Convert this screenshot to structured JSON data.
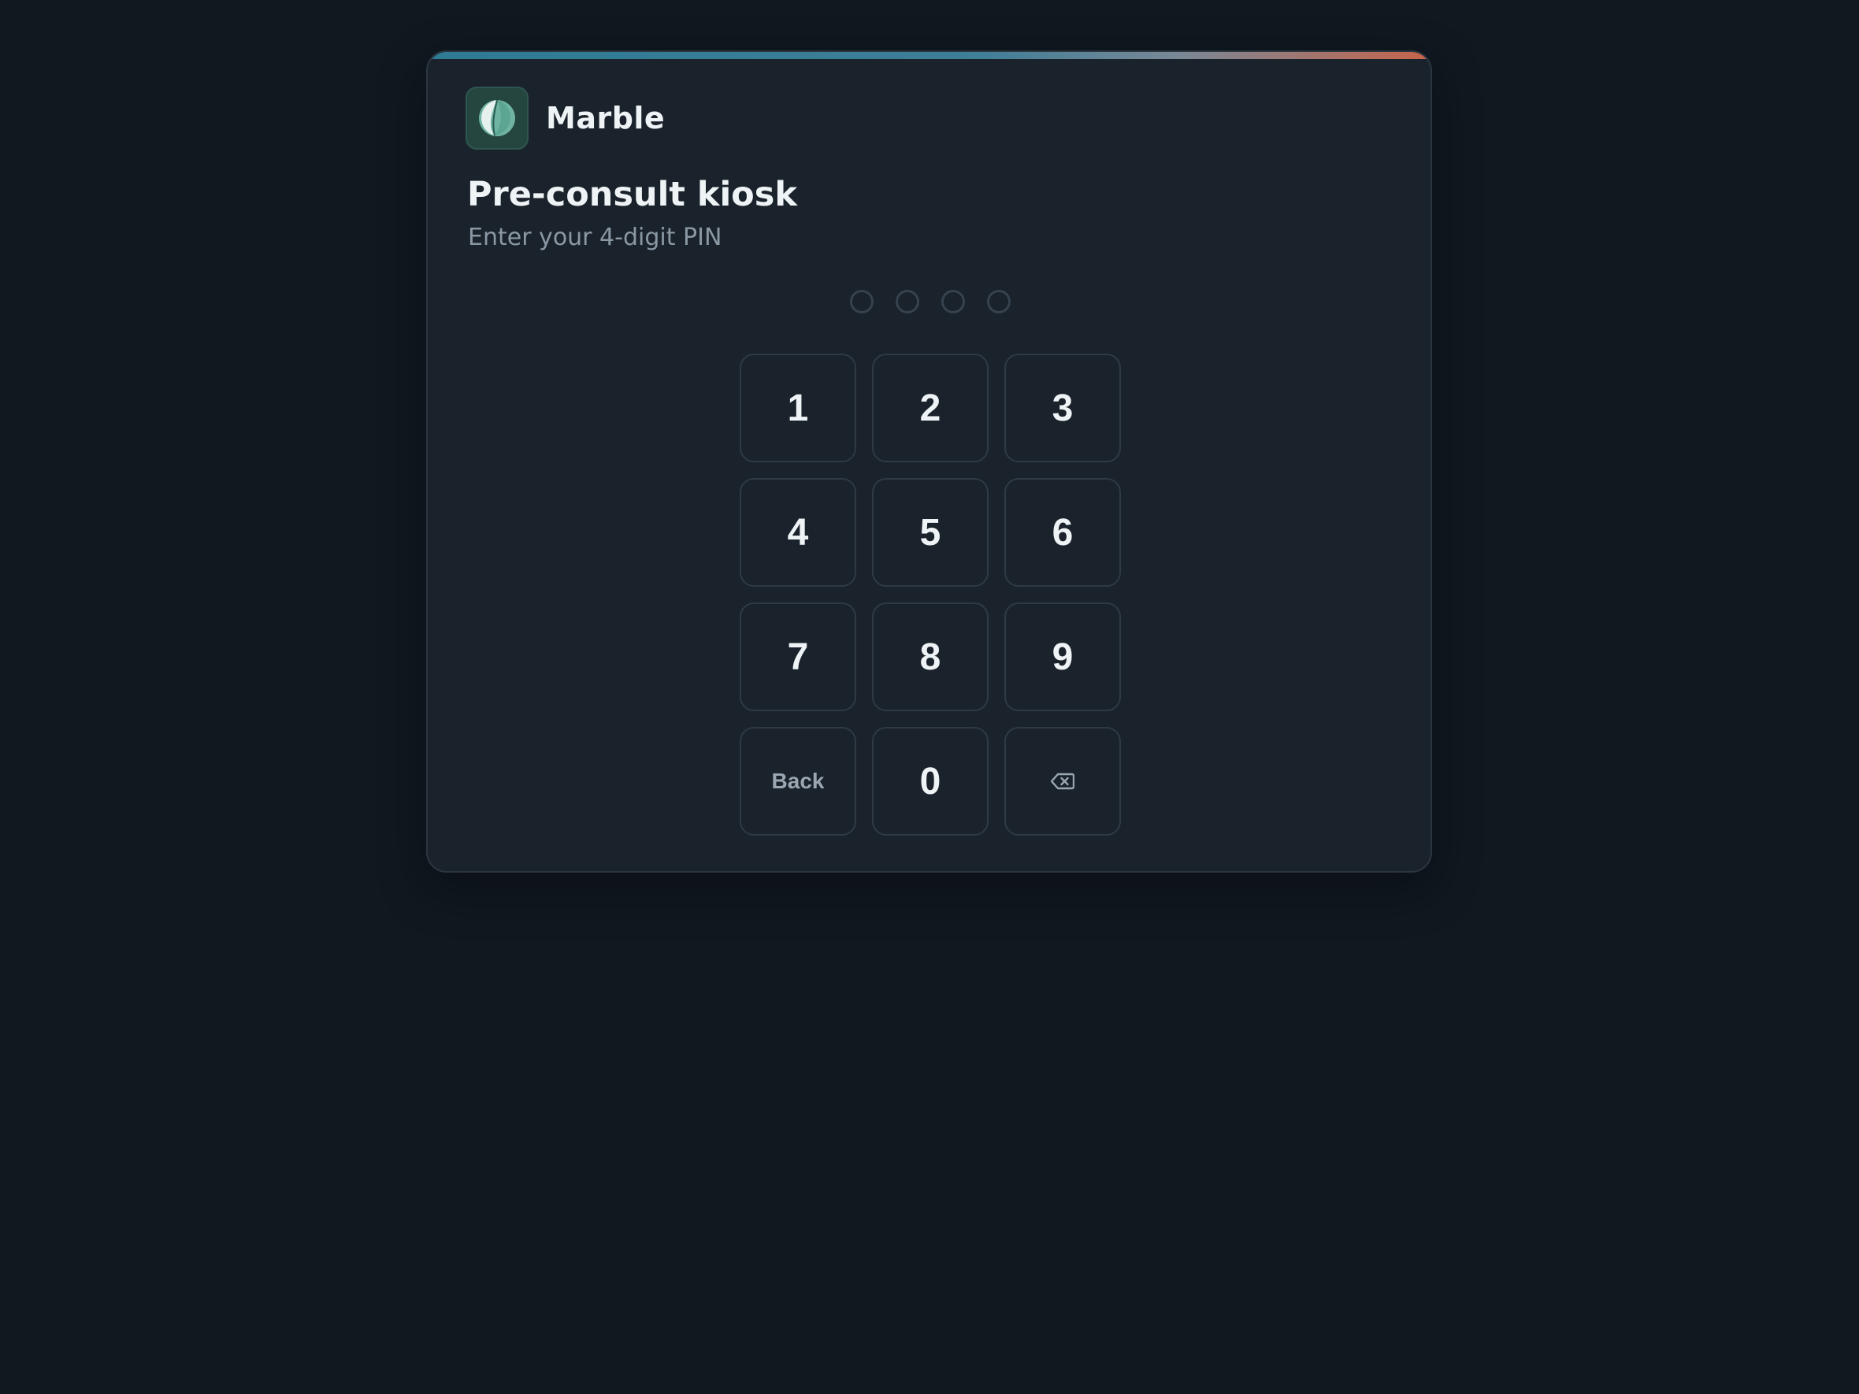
{
  "brand": {
    "name": "Marble",
    "logo_icon": "marble-logo-icon"
  },
  "kiosk": {
    "title": "Pre-consult kiosk",
    "subtitle": "Enter your 4-digit PIN"
  },
  "pin": {
    "length": 4,
    "entered": 0
  },
  "keypad": {
    "keys": [
      {
        "label": "1"
      },
      {
        "label": "2"
      },
      {
        "label": "3"
      },
      {
        "label": "4"
      },
      {
        "label": "5"
      },
      {
        "label": "6"
      },
      {
        "label": "7"
      },
      {
        "label": "8"
      },
      {
        "label": "9"
      },
      {
        "label": "Back"
      },
      {
        "label": "0"
      },
      {
        "icon": "backspace-icon"
      }
    ]
  },
  "colors": {
    "background": "#101820",
    "card": "#1a222b",
    "accent_start": "#2d7b93",
    "accent_end": "#c8644a",
    "logo_bg": "#25453f"
  }
}
